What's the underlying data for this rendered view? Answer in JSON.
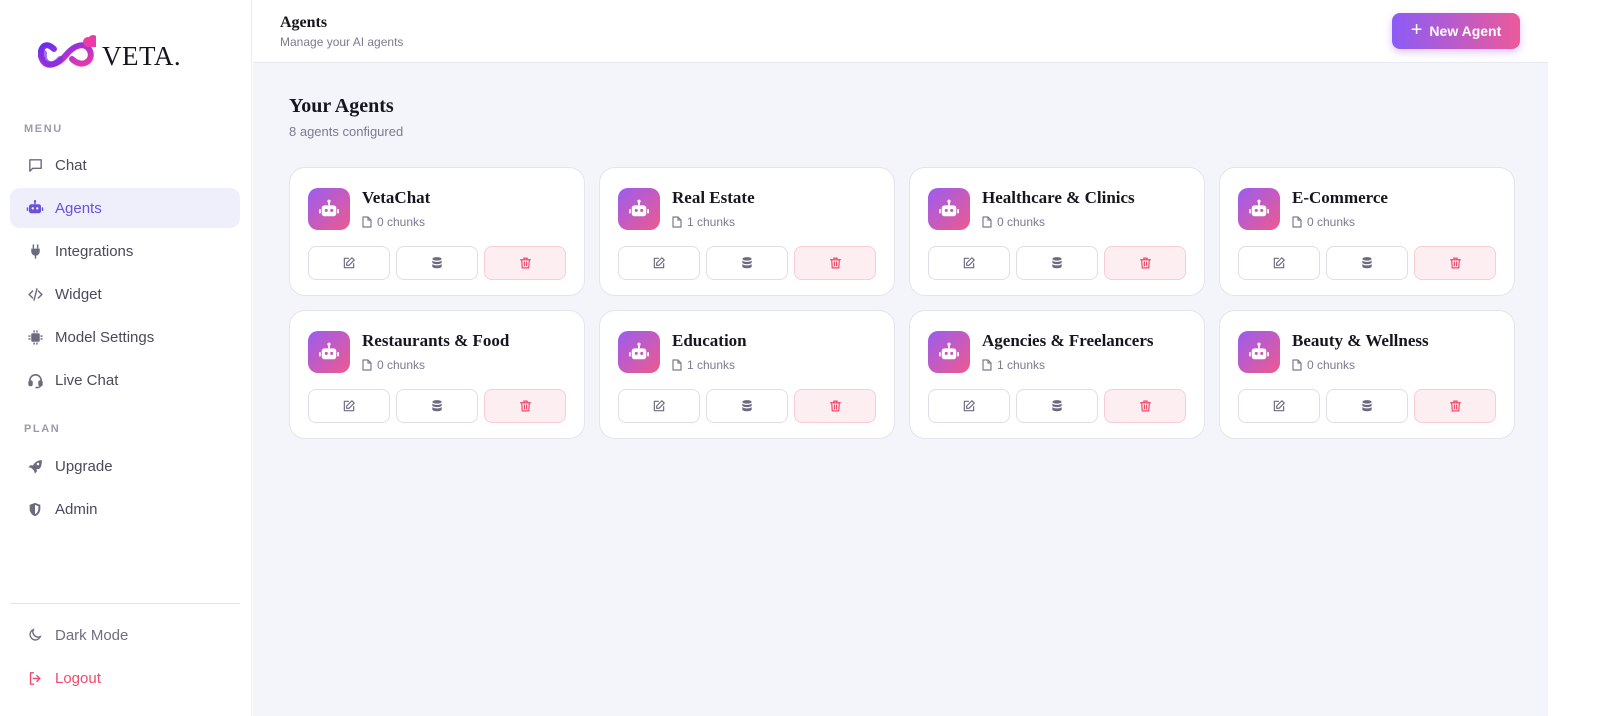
{
  "brand": {
    "name": "VETA."
  },
  "sidebar": {
    "menu_label": "MENU",
    "plan_label": "PLAN",
    "menu_items": [
      {
        "label": "Chat",
        "icon": "message-square-icon",
        "active": false
      },
      {
        "label": "Agents",
        "icon": "robot-icon",
        "active": true
      },
      {
        "label": "Integrations",
        "icon": "plug-icon",
        "active": false
      },
      {
        "label": "Widget",
        "icon": "code-icon",
        "active": false
      },
      {
        "label": "Model Settings",
        "icon": "cpu-icon",
        "active": false
      },
      {
        "label": "Live Chat",
        "icon": "headset-icon",
        "active": false
      }
    ],
    "plan_items": [
      {
        "label": "Upgrade",
        "icon": "rocket-icon"
      },
      {
        "label": "Admin",
        "icon": "shield-icon"
      }
    ],
    "footer": {
      "dark_mode": "Dark Mode",
      "logout": "Logout"
    }
  },
  "header": {
    "title": "Agents",
    "subtitle": "Manage your AI agents",
    "new_agent_label": "New Agent"
  },
  "main": {
    "section_title": "Your Agents",
    "section_subtitle": "8 agents configured",
    "agents": [
      {
        "name": "VetaChat",
        "chunks": "0 chunks"
      },
      {
        "name": "Real Estate",
        "chunks": "1 chunks"
      },
      {
        "name": "Healthcare & Clinics",
        "chunks": "0 chunks"
      },
      {
        "name": "E-Commerce",
        "chunks": "0 chunks"
      },
      {
        "name": "Restaurants & Food",
        "chunks": "0 chunks"
      },
      {
        "name": "Education",
        "chunks": "1 chunks"
      },
      {
        "name": "Agencies & Freelancers",
        "chunks": "1 chunks"
      },
      {
        "name": "Beauty & Wellness",
        "chunks": "0 chunks"
      }
    ]
  },
  "colors": {
    "accent": "#6b50e0",
    "gradient_start": "#8b5cf6",
    "gradient_end": "#ec5a9a",
    "danger": "#ef4a6a"
  }
}
